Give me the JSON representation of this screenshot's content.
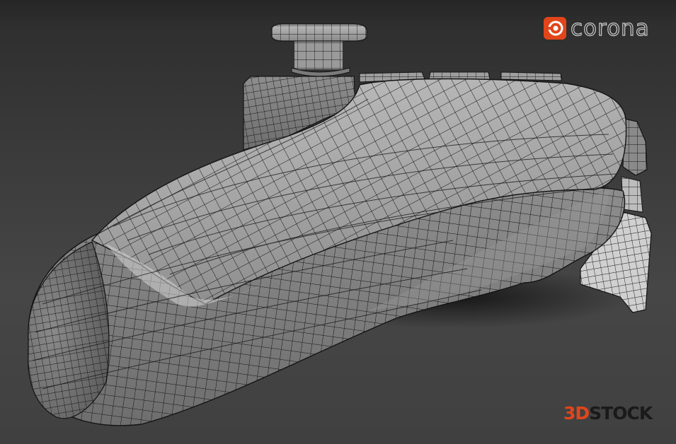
{
  "logos": {
    "corona": {
      "wordmark": "corona",
      "mark_color": "#e2451a",
      "text_color": "#c9c9c9"
    },
    "threed_stock": {
      "prefix": "3D",
      "suffix": "STOCK",
      "accent_color": "#e2451a",
      "base_color": "#1a1a1a"
    }
  },
  "scene": {
    "subject": "game-controller-grip-wireframe",
    "background_color": "#3a3a3a",
    "mesh_fill": "#9c9c9c",
    "mesh_line": "#141414"
  }
}
